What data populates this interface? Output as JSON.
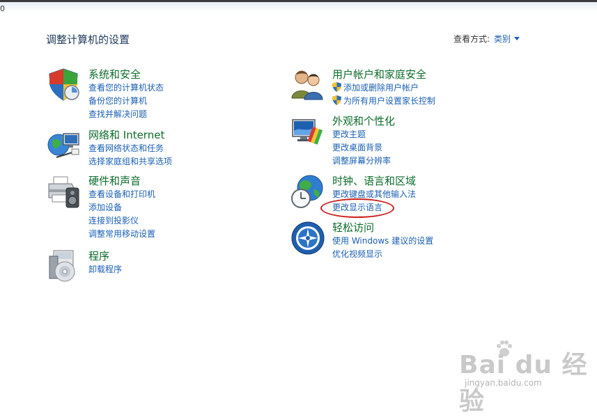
{
  "topbar": {
    "path_text": "0"
  },
  "header": {
    "title": "调整计算机的设置",
    "view_by_label": "查看方式:",
    "view_by_value": "类别"
  },
  "categories": {
    "system": {
      "title": "系统和安全",
      "links": [
        "查看您的计算机状态",
        "备份您的计算机",
        "查找并解决问题"
      ],
      "icon": "shield-security-icon"
    },
    "network": {
      "title": "网络和 Internet",
      "links": [
        "查看网络状态和任务",
        "选择家庭组和共享选项"
      ],
      "icon": "network-globe-icon"
    },
    "hardware": {
      "title": "硬件和声音",
      "links": [
        "查看设备和打印机",
        "添加设备",
        "连接到投影仪",
        "调整常用移动设置"
      ],
      "icon": "printer-speaker-icon"
    },
    "programs": {
      "title": "程序",
      "links": [
        "卸载程序"
      ],
      "icon": "programs-disc-icon"
    },
    "users": {
      "title": "用户帐户和家庭安全",
      "links": [
        "添加或删除用户帐户",
        "为所有用户设置家长控制"
      ],
      "icon": "users-icon"
    },
    "appearance": {
      "title": "外观和个性化",
      "links": [
        "更改主题",
        "更改桌面背景",
        "调整屏幕分辨率"
      ],
      "icon": "monitor-palette-icon"
    },
    "clock": {
      "title": "时钟、语言和区域",
      "links": [
        "更改键盘或其他输入法",
        "更改显示语言"
      ],
      "icon": "globe-clock-icon"
    },
    "ease": {
      "title": "轻松访问",
      "links": [
        "使用 Windows 建议的设置",
        "优化视频显示"
      ],
      "icon": "ease-of-access-icon"
    }
  },
  "annotation": {
    "color": "#cc1b1b"
  },
  "watermark": {
    "brand": "Bai du 经验",
    "url": "jingyan.baidu.com"
  },
  "colors": {
    "title_green": "#0b6b2a",
    "link_blue": "#1a5fb4"
  }
}
